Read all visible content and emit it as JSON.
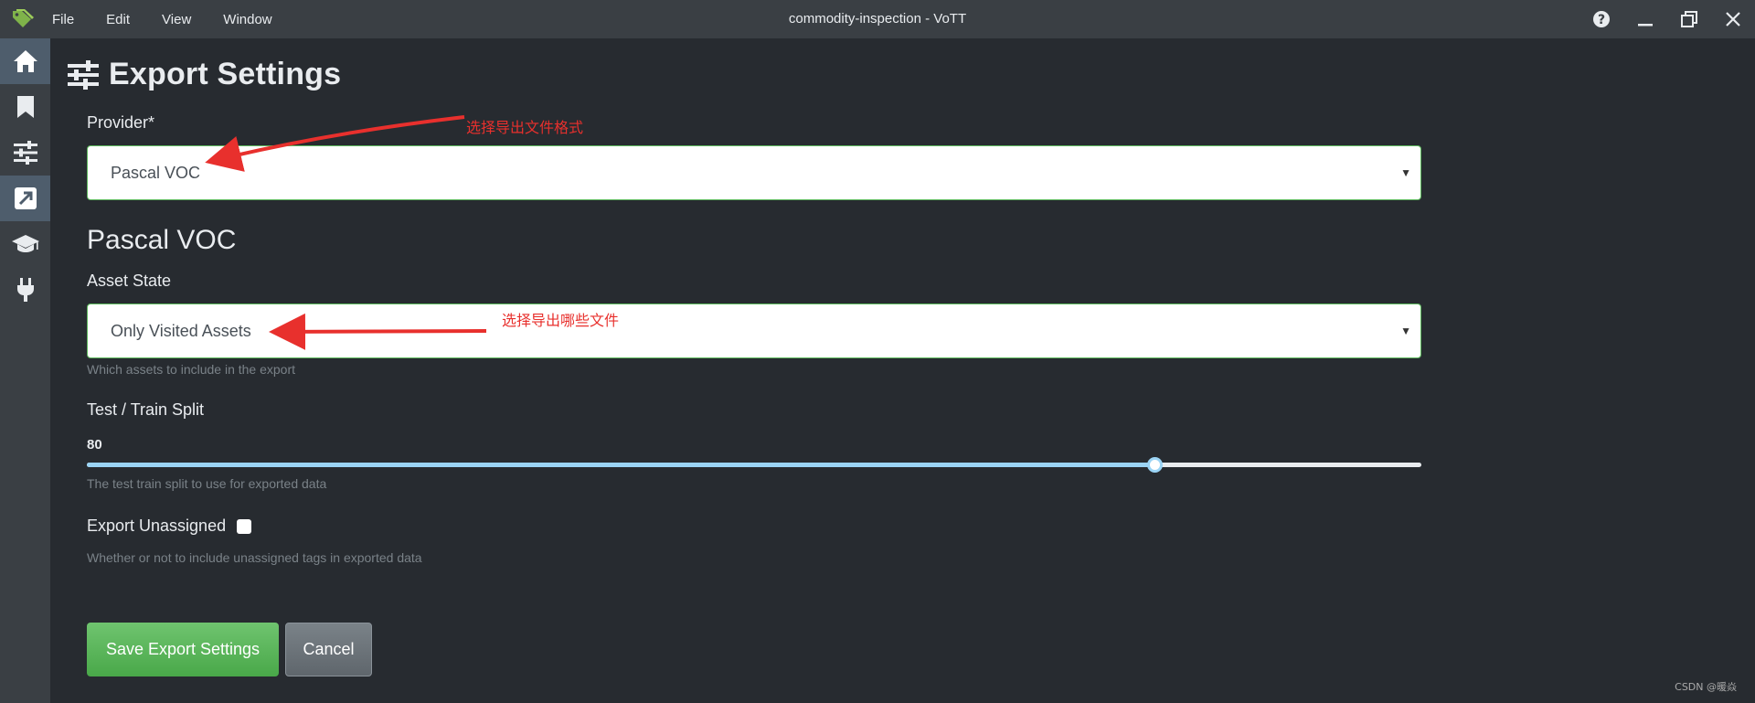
{
  "titlebar": {
    "menu": [
      "File",
      "Edit",
      "View",
      "Window"
    ],
    "title": "commodity-inspection - VoTT"
  },
  "sidebar": {
    "items": [
      {
        "icon": "home-icon"
      },
      {
        "icon": "bookmark-icon"
      },
      {
        "icon": "sliders-icon"
      },
      {
        "icon": "export-icon",
        "active": true
      },
      {
        "icon": "graduation-cap-icon"
      },
      {
        "icon": "plug-icon"
      }
    ]
  },
  "page": {
    "title": "Export Settings"
  },
  "form": {
    "provider_label": "Provider*",
    "provider_value": "Pascal VOC",
    "section_title": "Pascal VOC",
    "asset_state_label": "Asset State",
    "asset_state_value": "Only Visited Assets",
    "asset_state_help": "Which assets to include in the export",
    "split_label": "Test / Train Split",
    "split_value": "80",
    "split_fraction": 0.8,
    "split_help": "The test train split to use for exported data",
    "unassigned_label": "Export Unassigned",
    "unassigned_help": "Whether or not to include unassigned tags in exported data",
    "save_button": "Save Export Settings",
    "cancel_button": "Cancel"
  },
  "annotations": {
    "provider_note": "选择导出文件格式",
    "asset_note": "选择导出哪些文件"
  },
  "watermark": "CSDN @暖焱",
  "colors": {
    "accent_green": "#5cb85c",
    "slider": "#9bd4f5",
    "annotation": "#e8302d"
  }
}
